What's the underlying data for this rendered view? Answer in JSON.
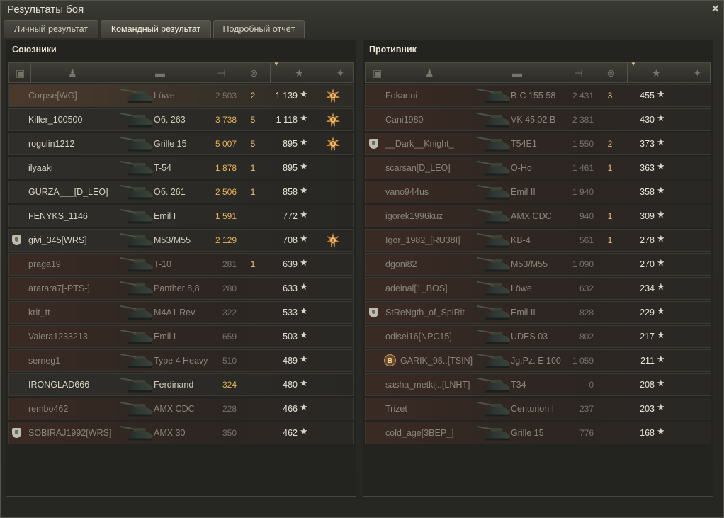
{
  "window": {
    "title": "Результаты боя",
    "close_icon": "×"
  },
  "tabs": [
    {
      "label": "Личный результат",
      "active": false
    },
    {
      "label": "Командный результат",
      "active": true
    },
    {
      "label": "Подробный отчёт",
      "active": false
    }
  ],
  "columns": {
    "icons": [
      "platoon-icon",
      "player-icon",
      "tank-icon",
      "damage-icon",
      "frags-icon",
      "xp-star-icon",
      "medal-icon"
    ],
    "sorted_by": "xp"
  },
  "colors": {
    "damage_gold": "#e2b25a",
    "frags_gold": "#e9c36f",
    "dead_name": "#8a857a",
    "alive_name": "#d8d3c0"
  },
  "allies": {
    "title": "Союзники",
    "rows": [
      {
        "name": "Corpse[WG]",
        "tank": "Löwe",
        "damage": "2 503",
        "frags": "2",
        "xp": "1 139",
        "medal": true,
        "alive": false,
        "dmg_highlight": false,
        "clan": false,
        "highlight": true
      },
      {
        "name": "Killer_100500",
        "tank": "Об. 263",
        "damage": "3 738",
        "frags": "5",
        "xp": "1 118",
        "medal": true,
        "alive": true,
        "dmg_highlight": true,
        "clan": false
      },
      {
        "name": "rogulin1212",
        "tank": "Grille 15",
        "damage": "5 007",
        "frags": "5",
        "xp": "895",
        "medal": true,
        "alive": true,
        "dmg_highlight": true,
        "clan": false
      },
      {
        "name": "ilyaaki",
        "tank": "T-54",
        "damage": "1 878",
        "frags": "1",
        "xp": "895",
        "medal": false,
        "alive": true,
        "dmg_highlight": true,
        "clan": false
      },
      {
        "name": "GURZA___[D_LEO]",
        "tank": "Об. 261",
        "damage": "2 506",
        "frags": "1",
        "xp": "858",
        "medal": false,
        "alive": true,
        "dmg_highlight": true,
        "clan": false
      },
      {
        "name": "FENYKS_1146",
        "tank": "Emil I",
        "damage": "1 591",
        "frags": "",
        "xp": "772",
        "medal": false,
        "alive": true,
        "dmg_highlight": true,
        "clan": false
      },
      {
        "name": "givi_345[WRS]",
        "tank": "M53/M55",
        "damage": "2 129",
        "frags": "",
        "xp": "708",
        "medal": true,
        "alive": true,
        "dmg_highlight": true,
        "clan": true
      },
      {
        "name": "praga19",
        "tank": "T-10",
        "damage": "281",
        "frags": "1",
        "xp": "639",
        "medal": false,
        "alive": false,
        "dmg_highlight": false,
        "clan": false
      },
      {
        "name": "arararа7[-PTS-]",
        "tank": "Panther 8,8",
        "damage": "280",
        "frags": "",
        "xp": "633",
        "medal": false,
        "alive": false,
        "dmg_highlight": false,
        "clan": false
      },
      {
        "name": "krit_tt",
        "tank": "M4A1 Rev.",
        "damage": "322",
        "frags": "",
        "xp": "533",
        "medal": false,
        "alive": false,
        "dmg_highlight": false,
        "clan": false
      },
      {
        "name": "Valera1233213",
        "tank": "Emil I",
        "damage": "659",
        "frags": "",
        "xp": "503",
        "medal": false,
        "alive": false,
        "dmg_highlight": false,
        "clan": false
      },
      {
        "name": "serneg1",
        "tank": "Type 4 Heavy",
        "damage": "510",
        "frags": "",
        "xp": "489",
        "medal": false,
        "alive": false,
        "dmg_highlight": false,
        "clan": false
      },
      {
        "name": "IRONGLAD666",
        "tank": "Ferdinand",
        "damage": "324",
        "frags": "",
        "xp": "480",
        "medal": false,
        "alive": true,
        "dmg_highlight": true,
        "clan": false
      },
      {
        "name": "rembo462",
        "tank": "AMX CDC",
        "damage": "228",
        "frags": "",
        "xp": "466",
        "medal": false,
        "alive": false,
        "dmg_highlight": false,
        "clan": false
      },
      {
        "name": "SOBIRAJ1992[WRS]",
        "tank": "AMX 30",
        "damage": "350",
        "frags": "",
        "xp": "462",
        "medal": false,
        "alive": false,
        "dmg_highlight": false,
        "clan": true
      }
    ]
  },
  "enemies": {
    "title": "Противник",
    "rows": [
      {
        "name": "Fokartni",
        "tank": "B-C 155 58",
        "damage": "2 431",
        "frags": "3",
        "xp": "455",
        "medal": false,
        "alive": false,
        "dmg_highlight": false,
        "clan": false
      },
      {
        "name": "Cani1980",
        "tank": "VK 45.02 B",
        "damage": "2 381",
        "frags": "",
        "xp": "430",
        "medal": false,
        "alive": false,
        "dmg_highlight": false,
        "clan": false
      },
      {
        "name": "__Dark__Knight_",
        "tank": "T54E1",
        "damage": "1 550",
        "frags": "2",
        "xp": "373",
        "medal": false,
        "alive": false,
        "dmg_highlight": false,
        "clan": true
      },
      {
        "name": "scarsan[D_LEO]",
        "tank": "O-Ho",
        "damage": "1 461",
        "frags": "1",
        "xp": "363",
        "medal": false,
        "alive": false,
        "dmg_highlight": false,
        "clan": false
      },
      {
        "name": "vano944us",
        "tank": "Emil II",
        "damage": "1 940",
        "frags": "",
        "xp": "358",
        "medal": false,
        "alive": false,
        "dmg_highlight": false,
        "clan": false
      },
      {
        "name": "igorek1996kuz",
        "tank": "AMX CDC",
        "damage": "940",
        "frags": "1",
        "xp": "309",
        "medal": false,
        "alive": false,
        "dmg_highlight": false,
        "clan": false
      },
      {
        "name": "Igor_1982_[RU38I]",
        "tank": "KB-4",
        "damage": "561",
        "frags": "1",
        "xp": "278",
        "medal": false,
        "alive": false,
        "dmg_highlight": false,
        "clan": false
      },
      {
        "name": "dgoni82",
        "tank": "M53/M55",
        "damage": "1 090",
        "frags": "",
        "xp": "270",
        "medal": false,
        "alive": false,
        "dmg_highlight": false,
        "clan": false
      },
      {
        "name": "adeinal[1_BOS]",
        "tank": "Löwe",
        "damage": "632",
        "frags": "",
        "xp": "234",
        "medal": false,
        "alive": false,
        "dmg_highlight": false,
        "clan": false
      },
      {
        "name": "StReNgth_of_SpiRit",
        "tank": "Emil II",
        "damage": "828",
        "frags": "",
        "xp": "229",
        "medal": false,
        "alive": false,
        "dmg_highlight": false,
        "clan": true
      },
      {
        "name": "odisei16[NPC15]",
        "tank": "UDES 03",
        "damage": "802",
        "frags": "",
        "xp": "217",
        "medal": false,
        "alive": false,
        "dmg_highlight": false,
        "clan": false
      },
      {
        "name": "GARIK_98..[TSIN]",
        "tank": "Jg.Pz. E 100",
        "damage": "1 059",
        "frags": "",
        "xp": "211",
        "medal": false,
        "alive": false,
        "dmg_highlight": false,
        "clan": false,
        "badge": "B"
      },
      {
        "name": "sasha_metkij..[LNHT]",
        "tank": "T34",
        "damage": "0",
        "frags": "",
        "xp": "208",
        "medal": false,
        "alive": false,
        "dmg_highlight": false,
        "clan": false
      },
      {
        "name": "Trizet",
        "tank": "Centurion I",
        "damage": "237",
        "frags": "",
        "xp": "203",
        "medal": false,
        "alive": false,
        "dmg_highlight": false,
        "clan": false
      },
      {
        "name": "cold_age[3BEP_]",
        "tank": "Grille 15",
        "damage": "776",
        "frags": "",
        "xp": "168",
        "medal": false,
        "alive": false,
        "dmg_highlight": false,
        "clan": false
      }
    ]
  }
}
